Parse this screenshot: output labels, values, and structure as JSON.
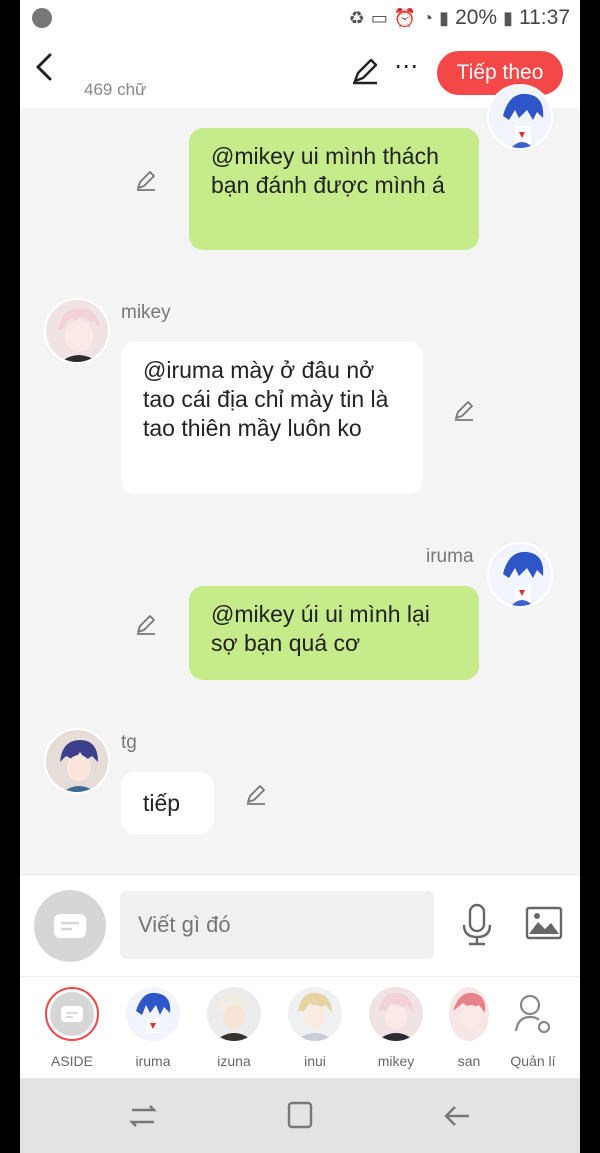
{
  "status_bar": {
    "battery": "20%",
    "time": "11:37"
  },
  "header": {
    "back_icon": "chevron-left-icon",
    "word_count": "469 chữ",
    "next_label": "Tiếp theo"
  },
  "messages": [
    {
      "side": "right",
      "sender": "",
      "text": "@mikey ui mình thách bạn đánh được mình á"
    },
    {
      "side": "left",
      "sender": "mikey",
      "text": "@iruma mày ở đâu nở tao cái địa chỉ mày tin là tao thiên mầy luôn ko"
    },
    {
      "side": "right",
      "sender": "iruma",
      "text": "@mikey úi ui mình lại sợ bạn quá cơ"
    },
    {
      "side": "left",
      "sender": "tg",
      "text": "tiếp"
    }
  ],
  "input": {
    "placeholder": "Viết gì đó"
  },
  "characters": [
    {
      "name": "ASIDE"
    },
    {
      "name": "iruma"
    },
    {
      "name": "izuna"
    },
    {
      "name": "inui"
    },
    {
      "name": "mikey"
    },
    {
      "name": "san"
    },
    {
      "name": "Quản lí"
    }
  ],
  "colors": {
    "accent": "#f44848",
    "bubble_right": "#c6eb8a",
    "bubble_left": "#ffffff"
  }
}
